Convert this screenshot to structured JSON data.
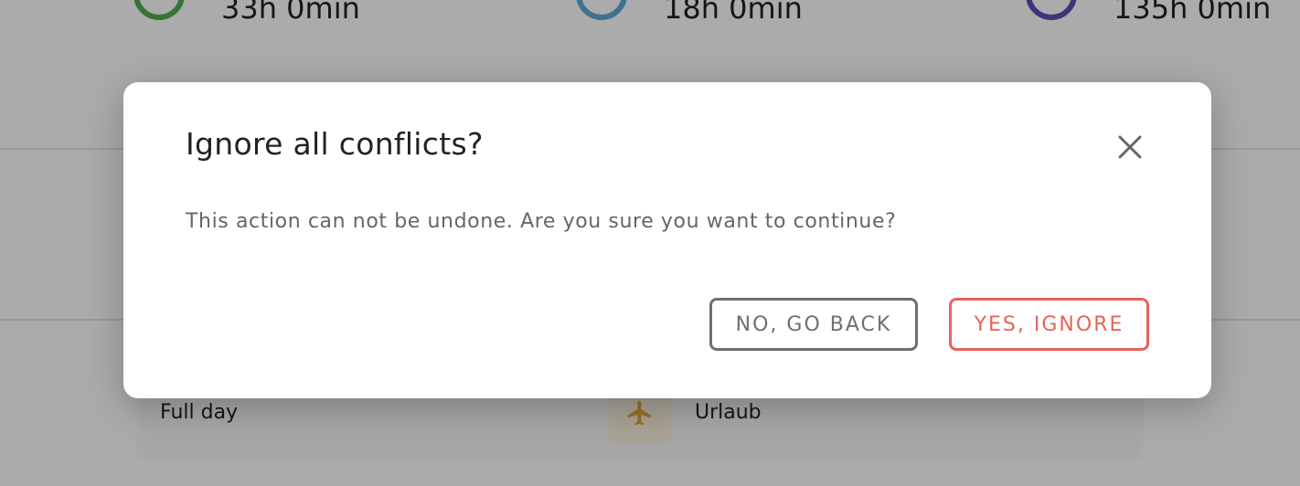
{
  "background": {
    "stats": [
      {
        "value": "33h 0min",
        "ring_color": "#4caf50"
      },
      {
        "value": "18h 0min",
        "ring_color": "#5ba9d6"
      },
      {
        "value": "135h 0min",
        "ring_color": "#5b4fb5"
      }
    ],
    "row": {
      "duration_label": "Full day",
      "absence_icon": "airplane-icon",
      "absence_type": "Urlaub"
    }
  },
  "dialog": {
    "title": "Ignore all conflicts?",
    "close_icon": "close-icon",
    "message": "This action can not be undone. Are you sure you want to continue?",
    "back_label": "NO, GO BACK",
    "confirm_label": "YES, IGNORE"
  },
  "colors": {
    "danger": "#e8625a",
    "neutral": "#6f6f6f",
    "absence_icon": "#e0a83a"
  }
}
